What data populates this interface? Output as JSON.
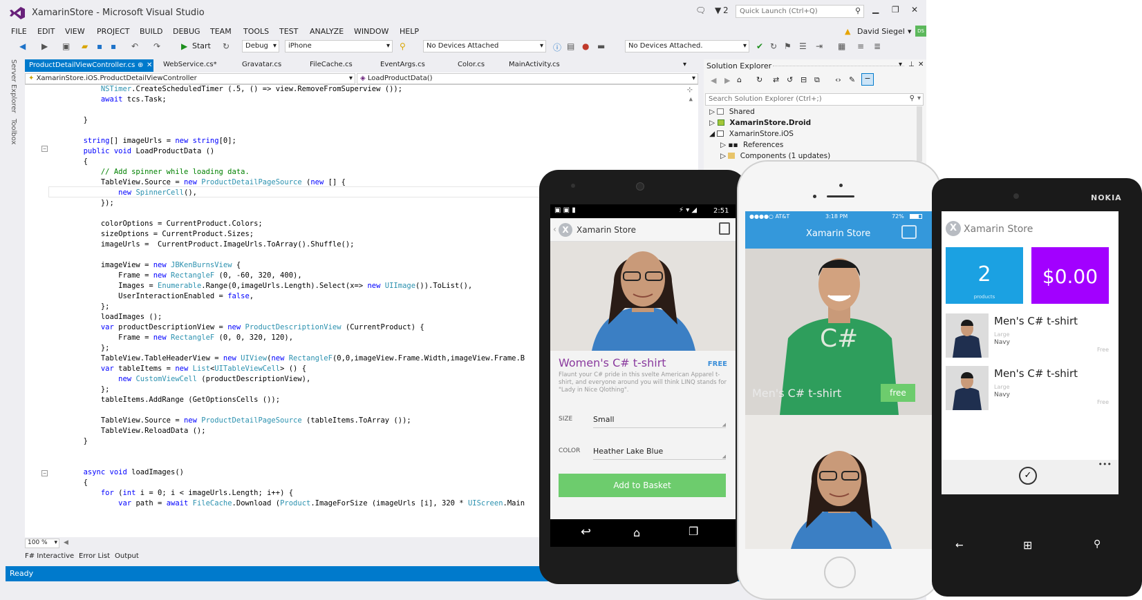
{
  "window": {
    "title": "XamarinStore - Microsoft Visual Studio",
    "notifications_count": "2",
    "quick_launch_placeholder": "Quick Launch (Ctrl+Q)",
    "user_name": "David Siegel",
    "user_initials": "DS"
  },
  "menu": [
    "FILE",
    "EDIT",
    "VIEW",
    "PROJECT",
    "BUILD",
    "DEBUG",
    "TEAM",
    "TOOLS",
    "TEST",
    "ANALYZE",
    "WINDOW",
    "HELP"
  ],
  "toolbar": {
    "start_label": "Start",
    "config": "Debug",
    "platform": "iPhone",
    "device_left": "No Devices Attached",
    "device_right": "No Devices Attached."
  },
  "side_tabs": [
    "Server Explorer",
    "Toolbox"
  ],
  "doc_tabs": [
    "ProductDetailViewController.cs",
    "WebService.cs*",
    "Gravatar.cs",
    "FileCache.cs",
    "EventArgs.cs",
    "Color.cs",
    "MainActivity.cs"
  ],
  "nav": {
    "class_path": "XamarinStore.iOS.ProductDetailViewController",
    "member": "LoadProductData()"
  },
  "code_lines": [
    "            NSTimer.CreateScheduledTimer (.5, () => view.RemoveFromSuperview ());",
    "            await tcs.Task;",
    "",
    "        }",
    "",
    "        string[] imageUrls = new string[0];",
    "        public void LoadProductData ()",
    "        {",
    "            // Add spinner while loading data.",
    "            TableView.Source = new ProductDetailPageSource (new [] {",
    "                new SpinnerCell(),",
    "            });",
    "",
    "            colorOptions = CurrentProduct.Colors;",
    "            sizeOptions = CurrentProduct.Sizes;",
    "            imageUrls =  CurrentProduct.ImageUrls.ToArray().Shuffle();",
    "",
    "            imageView = new JBKenBurnsView {",
    "                Frame = new RectangleF (0, -60, 320, 400),",
    "                Images = Enumerable.Range(0,imageUrls.Length).Select(x=> new UIImage()).ToList(),",
    "                UserInteractionEnabled = false,",
    "            };",
    "            loadImages ();",
    "            var productDescriptionView = new ProductDescriptionView (CurrentProduct) {",
    "                Frame = new RectangleF (0, 0, 320, 120),",
    "            };",
    "            TableView.TableHeaderView = new UIView(new RectangleF(0,0,imageView.Frame.Width,imageView.Frame.B",
    "            var tableItems = new List<UITableViewCell> () {",
    "                new CustomViewCell (productDescriptionView),",
    "            };",
    "            tableItems.AddRange (GetOptionsCells ());",
    "",
    "            TableView.Source = new ProductDetailPageSource (tableItems.ToArray ());",
    "            TableView.ReloadData ();",
    "        }",
    "",
    "",
    "        async void loadImages()",
    "        {",
    "            for (int i = 0; i < imageUrls.Length; i++) {",
    "                var path = await FileCache.Download (Product.ImageForSize (imageUrls [i], 320 * UIScreen.Main"
  ],
  "editor": {
    "zoom": "100 %"
  },
  "bottom_tabs": [
    "F# Interactive",
    "Error List",
    "Output"
  ],
  "status": "Ready",
  "solution_explorer": {
    "title": "Solution Explorer",
    "search_placeholder": "Search Solution Explorer (Ctrl+;)",
    "items": [
      {
        "label": "Shared",
        "bold": false
      },
      {
        "label": "XamarinStore.Droid",
        "bold": true
      },
      {
        "label": "XamarinStore.iOS",
        "bold": false
      },
      {
        "label": "References",
        "bold": false
      },
      {
        "label": "Components (1 updates)",
        "bold": false
      }
    ]
  },
  "android_app": {
    "status_time": "2:51",
    "app_title": "Xamarin Store",
    "product_name": "Women's C# t-shirt",
    "price": "FREE",
    "description": "Flaunt your C# pride in this svelte American Apparel t-shirt, and everyone around you will think LINQ stands for \"Lady in Nice Qlothing\".",
    "size_label": "SIZE",
    "size_value": "Small",
    "color_label": "COLOR",
    "color_value": "Heather Lake Blue",
    "add_button": "Add to Basket"
  },
  "iphone_app": {
    "carrier": "●●●●○ AT&T",
    "time": "3:18 PM",
    "battery": "72%",
    "app_title": "Xamarin Store",
    "product_name": "Men's C# t-shirt",
    "price": "free",
    "shirt_text": "C#"
  },
  "winphone_app": {
    "brand": "NOKIA",
    "app_title": "Xamarin Store",
    "tile_count": "2",
    "tile_count_label": "products",
    "tile_total": "$0.00",
    "items": [
      {
        "name": "Men's C# t-shirt",
        "size": "Large",
        "color": "Navy",
        "price": "Free"
      },
      {
        "name": "Men's C# t-shirt",
        "size": "Large",
        "color": "Navy",
        "price": "Free"
      }
    ],
    "more": "•••"
  },
  "colors": {
    "vs_blue": "#007acc",
    "vs_purple": "#68217a",
    "ios_blue": "#3498db",
    "android_green": "#6dcc6d",
    "wp_cyan": "#1ba1e2",
    "wp_purple": "#a200ff",
    "tshirt_green": "#2e9e5c"
  }
}
